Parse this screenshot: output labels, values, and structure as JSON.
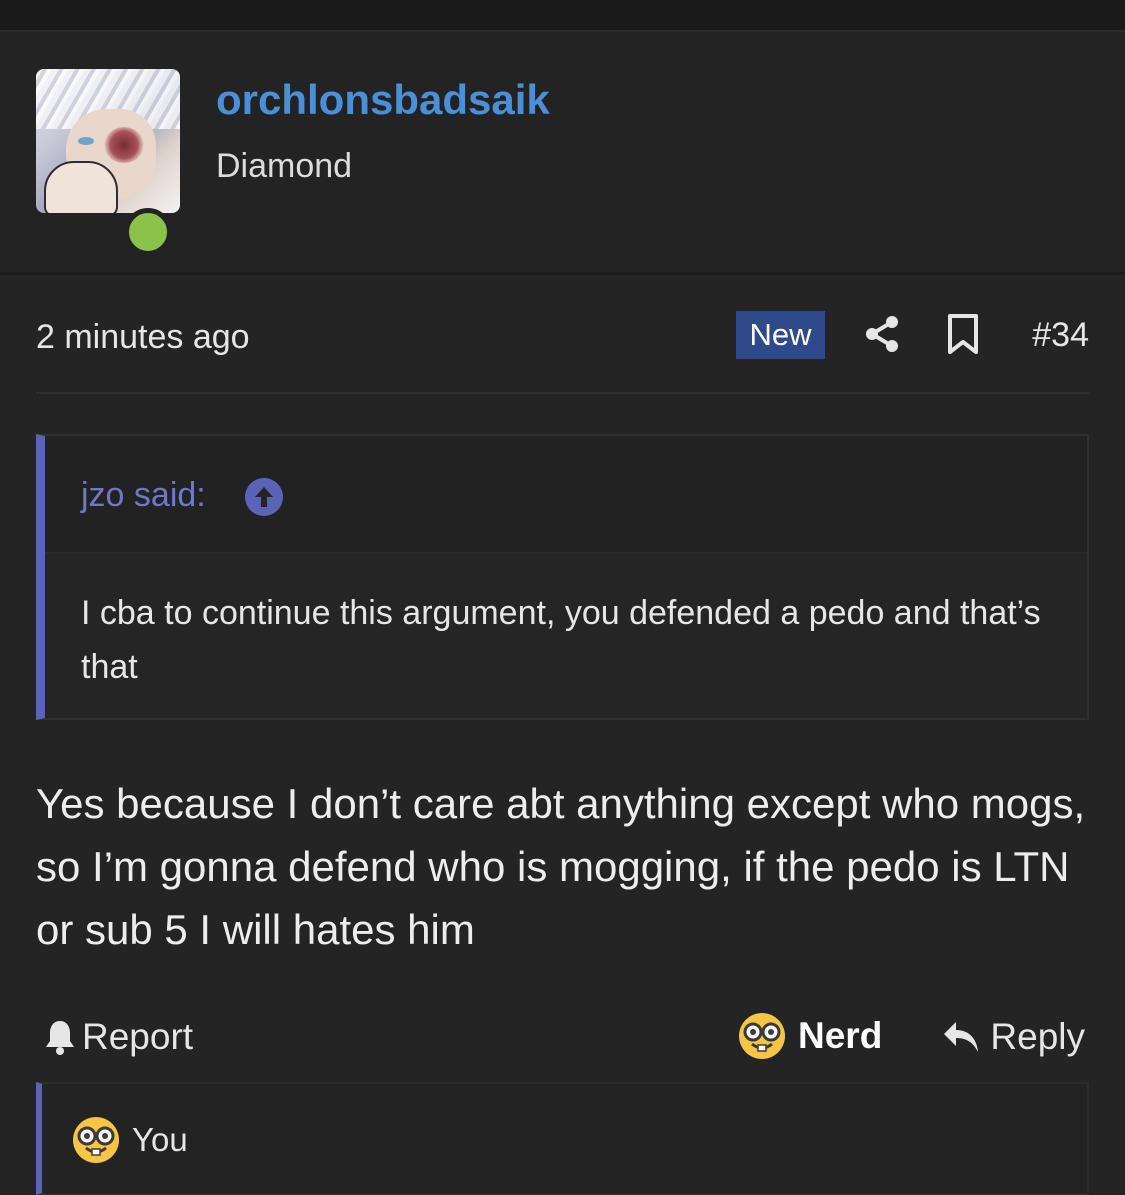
{
  "user": {
    "name": "orchlonsbadsaik",
    "title": "Diamond",
    "online_color": "#8bc34a"
  },
  "meta": {
    "time": "2 minutes ago",
    "badge": "New",
    "post_number": "#34",
    "icons": [
      "share-icon",
      "bookmark-icon"
    ]
  },
  "quote": {
    "author": "jzo said:",
    "text": "I cba to continue this argument, you defended a pedo and that’s that"
  },
  "message": "Yes because I don’t care abt anything except who mogs, so I’m gonna defend who is mogging, if the pedo is LTN or sub 5 I will hates him",
  "actions": {
    "report": "Report",
    "nerd": "Nerd",
    "reply": "Reply"
  },
  "reactions": {
    "label": "You"
  },
  "colors": {
    "accent": "#5b63b7",
    "username": "#4a90d9",
    "badge": "#2e4a8a"
  }
}
